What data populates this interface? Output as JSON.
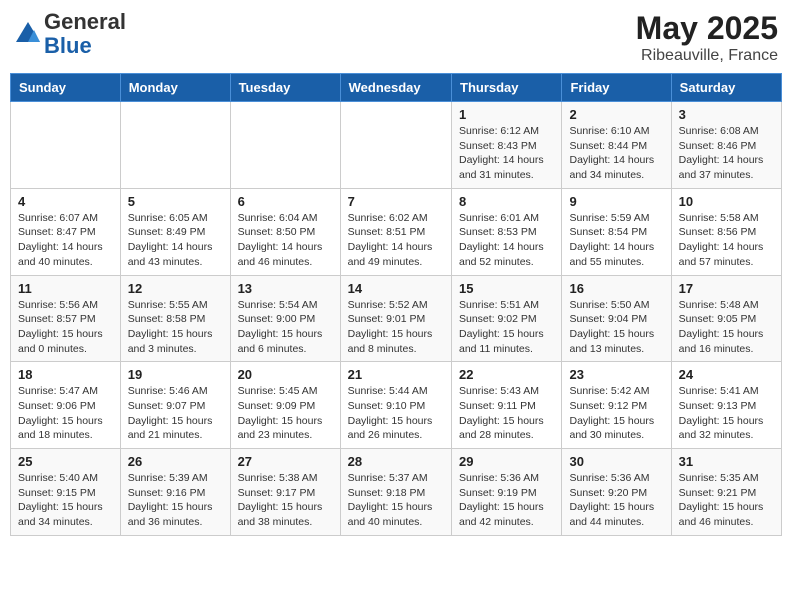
{
  "header": {
    "logo_general": "General",
    "logo_blue": "Blue",
    "month_title": "May 2025",
    "location": "Ribeauville, France"
  },
  "weekdays": [
    "Sunday",
    "Monday",
    "Tuesday",
    "Wednesday",
    "Thursday",
    "Friday",
    "Saturday"
  ],
  "weeks": [
    [
      {
        "day": "",
        "info": ""
      },
      {
        "day": "",
        "info": ""
      },
      {
        "day": "",
        "info": ""
      },
      {
        "day": "",
        "info": ""
      },
      {
        "day": "1",
        "info": "Sunrise: 6:12 AM\nSunset: 8:43 PM\nDaylight: 14 hours\nand 31 minutes."
      },
      {
        "day": "2",
        "info": "Sunrise: 6:10 AM\nSunset: 8:44 PM\nDaylight: 14 hours\nand 34 minutes."
      },
      {
        "day": "3",
        "info": "Sunrise: 6:08 AM\nSunset: 8:46 PM\nDaylight: 14 hours\nand 37 minutes."
      }
    ],
    [
      {
        "day": "4",
        "info": "Sunrise: 6:07 AM\nSunset: 8:47 PM\nDaylight: 14 hours\nand 40 minutes."
      },
      {
        "day": "5",
        "info": "Sunrise: 6:05 AM\nSunset: 8:49 PM\nDaylight: 14 hours\nand 43 minutes."
      },
      {
        "day": "6",
        "info": "Sunrise: 6:04 AM\nSunset: 8:50 PM\nDaylight: 14 hours\nand 46 minutes."
      },
      {
        "day": "7",
        "info": "Sunrise: 6:02 AM\nSunset: 8:51 PM\nDaylight: 14 hours\nand 49 minutes."
      },
      {
        "day": "8",
        "info": "Sunrise: 6:01 AM\nSunset: 8:53 PM\nDaylight: 14 hours\nand 52 minutes."
      },
      {
        "day": "9",
        "info": "Sunrise: 5:59 AM\nSunset: 8:54 PM\nDaylight: 14 hours\nand 55 minutes."
      },
      {
        "day": "10",
        "info": "Sunrise: 5:58 AM\nSunset: 8:56 PM\nDaylight: 14 hours\nand 57 minutes."
      }
    ],
    [
      {
        "day": "11",
        "info": "Sunrise: 5:56 AM\nSunset: 8:57 PM\nDaylight: 15 hours\nand 0 minutes."
      },
      {
        "day": "12",
        "info": "Sunrise: 5:55 AM\nSunset: 8:58 PM\nDaylight: 15 hours\nand 3 minutes."
      },
      {
        "day": "13",
        "info": "Sunrise: 5:54 AM\nSunset: 9:00 PM\nDaylight: 15 hours\nand 6 minutes."
      },
      {
        "day": "14",
        "info": "Sunrise: 5:52 AM\nSunset: 9:01 PM\nDaylight: 15 hours\nand 8 minutes."
      },
      {
        "day": "15",
        "info": "Sunrise: 5:51 AM\nSunset: 9:02 PM\nDaylight: 15 hours\nand 11 minutes."
      },
      {
        "day": "16",
        "info": "Sunrise: 5:50 AM\nSunset: 9:04 PM\nDaylight: 15 hours\nand 13 minutes."
      },
      {
        "day": "17",
        "info": "Sunrise: 5:48 AM\nSunset: 9:05 PM\nDaylight: 15 hours\nand 16 minutes."
      }
    ],
    [
      {
        "day": "18",
        "info": "Sunrise: 5:47 AM\nSunset: 9:06 PM\nDaylight: 15 hours\nand 18 minutes."
      },
      {
        "day": "19",
        "info": "Sunrise: 5:46 AM\nSunset: 9:07 PM\nDaylight: 15 hours\nand 21 minutes."
      },
      {
        "day": "20",
        "info": "Sunrise: 5:45 AM\nSunset: 9:09 PM\nDaylight: 15 hours\nand 23 minutes."
      },
      {
        "day": "21",
        "info": "Sunrise: 5:44 AM\nSunset: 9:10 PM\nDaylight: 15 hours\nand 26 minutes."
      },
      {
        "day": "22",
        "info": "Sunrise: 5:43 AM\nSunset: 9:11 PM\nDaylight: 15 hours\nand 28 minutes."
      },
      {
        "day": "23",
        "info": "Sunrise: 5:42 AM\nSunset: 9:12 PM\nDaylight: 15 hours\nand 30 minutes."
      },
      {
        "day": "24",
        "info": "Sunrise: 5:41 AM\nSunset: 9:13 PM\nDaylight: 15 hours\nand 32 minutes."
      }
    ],
    [
      {
        "day": "25",
        "info": "Sunrise: 5:40 AM\nSunset: 9:15 PM\nDaylight: 15 hours\nand 34 minutes."
      },
      {
        "day": "26",
        "info": "Sunrise: 5:39 AM\nSunset: 9:16 PM\nDaylight: 15 hours\nand 36 minutes."
      },
      {
        "day": "27",
        "info": "Sunrise: 5:38 AM\nSunset: 9:17 PM\nDaylight: 15 hours\nand 38 minutes."
      },
      {
        "day": "28",
        "info": "Sunrise: 5:37 AM\nSunset: 9:18 PM\nDaylight: 15 hours\nand 40 minutes."
      },
      {
        "day": "29",
        "info": "Sunrise: 5:36 AM\nSunset: 9:19 PM\nDaylight: 15 hours\nand 42 minutes."
      },
      {
        "day": "30",
        "info": "Sunrise: 5:36 AM\nSunset: 9:20 PM\nDaylight: 15 hours\nand 44 minutes."
      },
      {
        "day": "31",
        "info": "Sunrise: 5:35 AM\nSunset: 9:21 PM\nDaylight: 15 hours\nand 46 minutes."
      }
    ]
  ]
}
